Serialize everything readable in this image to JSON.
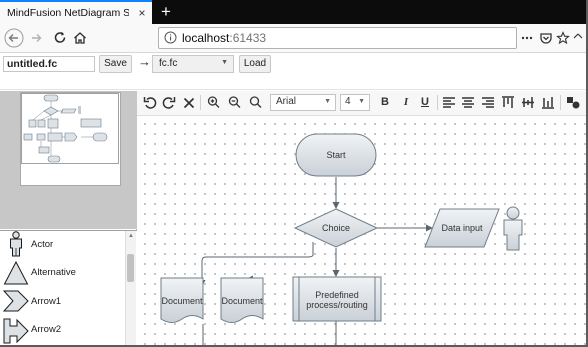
{
  "browser": {
    "tab_title": "MindFusion NetDiagram Sample - |",
    "tab_close": "×",
    "new_tab": "+",
    "url_host": "localhost",
    "url_port": ":61433",
    "url_icon": "info-icon",
    "nav_icons": [
      "back-arrow-icon",
      "forward-arrow-icon",
      "reload-icon",
      "home-icon"
    ],
    "right_icons": [
      "more-dots-icon",
      "pocket-icon",
      "bookmark-star-icon",
      "menu-chevron-icon"
    ],
    "accent": "#0a84ff"
  },
  "toolbar": {
    "filename": "untitled.fc",
    "save_label": "Save",
    "arrow": "→",
    "file_select": "fc.fc",
    "load_label": "Load"
  },
  "editor": {
    "font": "Arial",
    "size": "4",
    "bold": "B",
    "italic": "I",
    "underline": "U",
    "tools": [
      "undo-icon",
      "redo-icon",
      "delete-icon",
      "zoom-in-icon",
      "zoom-out-icon",
      "zoom-reset-icon",
      "bold-icon",
      "italic-icon",
      "underline-icon",
      "align-left-icon",
      "align-center-icon",
      "align-right-icon",
      "valign-top-icon",
      "valign-middle-icon",
      "valign-bottom-icon",
      "shape-style-icon"
    ]
  },
  "palette": {
    "items": [
      {
        "label": "Actor",
        "icon": "actor-shape-icon"
      },
      {
        "label": "Alternative",
        "icon": "alternative-shape-icon"
      },
      {
        "label": "Arrow1",
        "icon": "arrow1-shape-icon"
      },
      {
        "label": "Arrow2",
        "icon": "arrow2-shape-icon"
      }
    ]
  },
  "diagram": {
    "nodes": {
      "start": "Start",
      "choice": "Choice",
      "data_input": "Data input",
      "document1": "Document",
      "document2": "Document",
      "predefined_line1": "Predefined",
      "predefined_line2": "process/routing"
    },
    "node_fill": "#dde2e7",
    "node_stroke": "#6f7d8a",
    "link_color": "#5a6670"
  }
}
